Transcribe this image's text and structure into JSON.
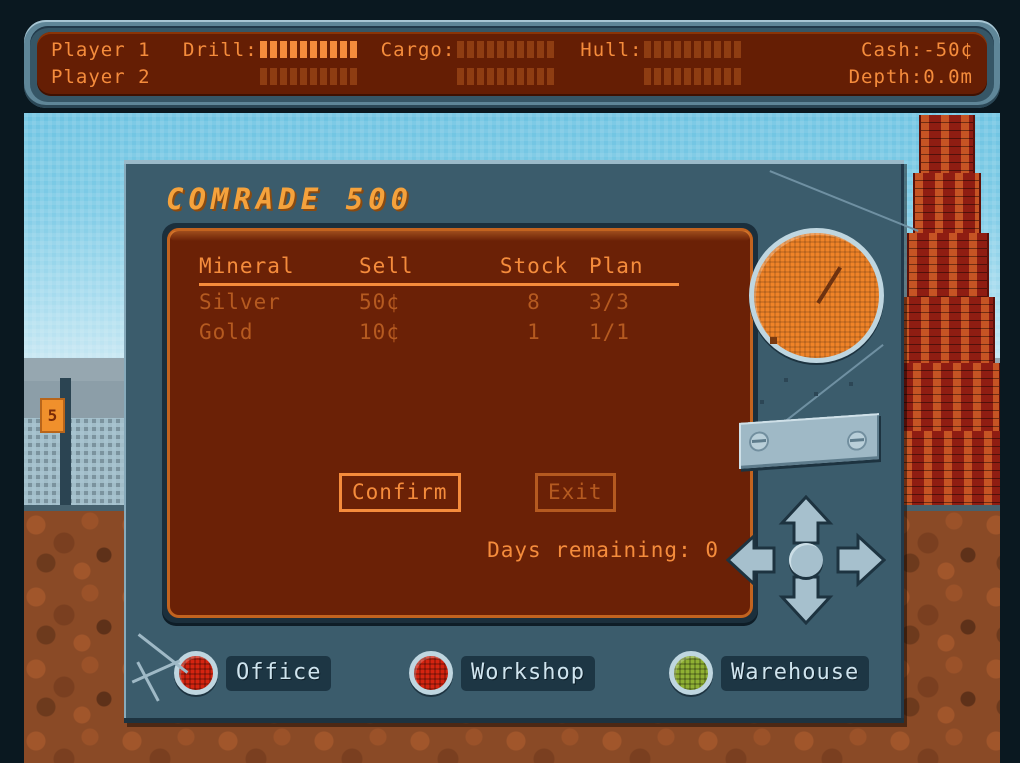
{
  "game": {
    "title": "COMRADE 500"
  },
  "status_bar": {
    "players": [
      {
        "name": "Player 1",
        "drill_filled": 10,
        "drill_total": 10,
        "cargo_filled": 0,
        "cargo_total": 10,
        "hull_filled": 0,
        "hull_total": 10
      },
      {
        "name": "Player 2",
        "drill_filled": 0,
        "drill_total": 10,
        "cargo_filled": 0,
        "cargo_total": 10,
        "hull_filled": 0,
        "hull_total": 10
      }
    ],
    "labels": {
      "drill": "Drill:",
      "cargo": "Cargo:",
      "hull": "Hull:"
    },
    "cash": "Cash:-50¢",
    "depth": "Depth:0.0m"
  },
  "table": {
    "headers": [
      "Mineral",
      "Sell",
      "Stock",
      "Plan"
    ],
    "rows": [
      {
        "mineral": "Silver",
        "sell": "50¢",
        "stock": "8",
        "plan": "3/3"
      },
      {
        "mineral": "Gold",
        "sell": "10¢",
        "stock": "1",
        "plan": "1/1"
      }
    ]
  },
  "buttons": {
    "confirm": "Confirm",
    "exit": "Exit"
  },
  "days_remaining": "Days remaining: 0",
  "tabs": [
    {
      "label": "Office",
      "lamp": "red",
      "active": false
    },
    {
      "label": "Workshop",
      "lamp": "red",
      "active": false
    },
    {
      "label": "Warehouse",
      "lamp": "green",
      "active": true
    }
  ],
  "scenery": {
    "sign_text": "5"
  },
  "colors": {
    "accent_orange": "#f58c3c",
    "dim_orange": "#b55a20",
    "screen_bg": "#6b2106",
    "panel_blue": "#3b5c6c",
    "lamp_red": "#d42410",
    "lamp_green": "#8fb033",
    "sky": "#7ecbe6",
    "brick": "#8f1d12",
    "dirt": "#8a4a26"
  }
}
